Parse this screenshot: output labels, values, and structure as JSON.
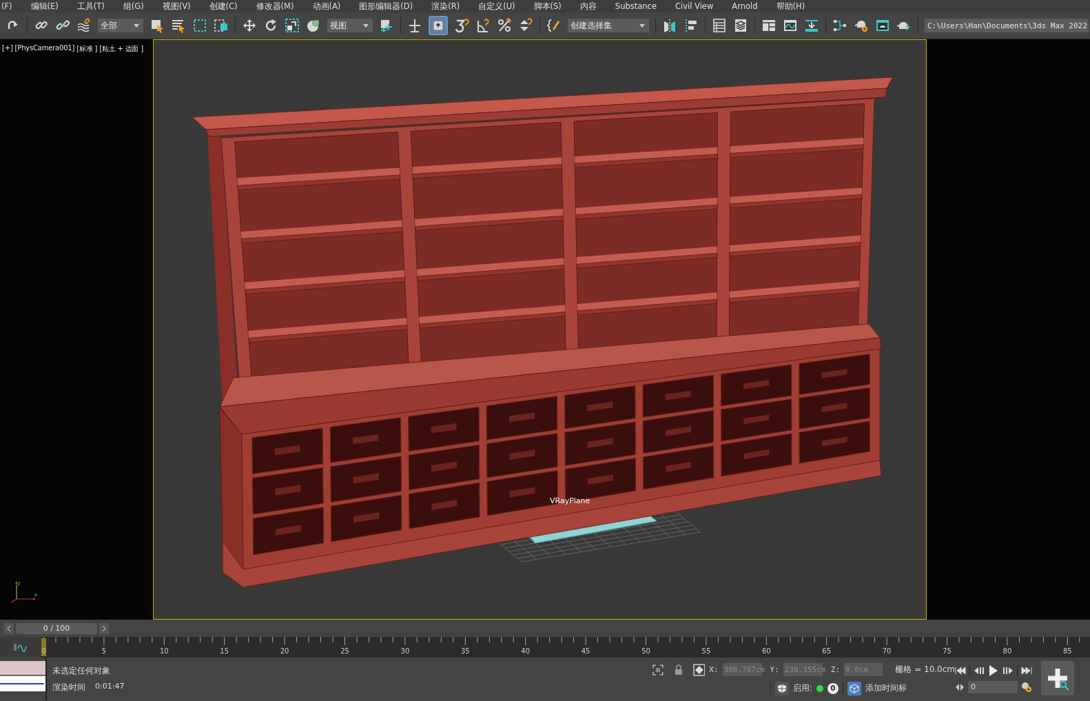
{
  "menu": [
    "(F)",
    "编辑(E)",
    "工具(T)",
    "组(G)",
    "视图(V)",
    "创建(C)",
    "修改器(M)",
    "动画(A)",
    "图形编辑器(D)",
    "渲染(R)",
    "自定义(U)",
    "脚本(S)",
    "内容",
    "Substance",
    "Civil View",
    "Arnold",
    "帮助(H)"
  ],
  "toolbar": {
    "selection_filter": "全部",
    "reference_coordinate": "视图",
    "named_selection_set": "创建选择集",
    "project_path": "C:\\Users\\Han\\Documents\\3ds Max 2022",
    "snap_toggle_on": true
  },
  "viewport": {
    "label": [
      "[+]",
      "[PhysCamera001]",
      "[标准 ]",
      "[粘土 + 边面 ]"
    ],
    "object_label": "VRayPlane"
  },
  "timeline": {
    "frame_counter": "0 / 100",
    "ticks": [
      "0",
      "5",
      "10",
      "15",
      "20",
      "25",
      "30",
      "35",
      "40",
      "45",
      "50",
      "55",
      "60",
      "65",
      "70",
      "75",
      "80",
      "85"
    ]
  },
  "status": {
    "selection": "未选定任何对象",
    "render_time_label": "渲染时间",
    "render_time": "0:01:47",
    "x_label": "X:",
    "x": "388.787cm",
    "y_label": "Y:",
    "y": "238.355cm",
    "z_label": "Z:",
    "z": "0.0cm",
    "grid": "栅格 = 10.0cm",
    "enabled_label": "启用:",
    "enabled_on": true,
    "key_count": "0",
    "add_time_tag": "添加时间标",
    "current_frame": "0"
  }
}
